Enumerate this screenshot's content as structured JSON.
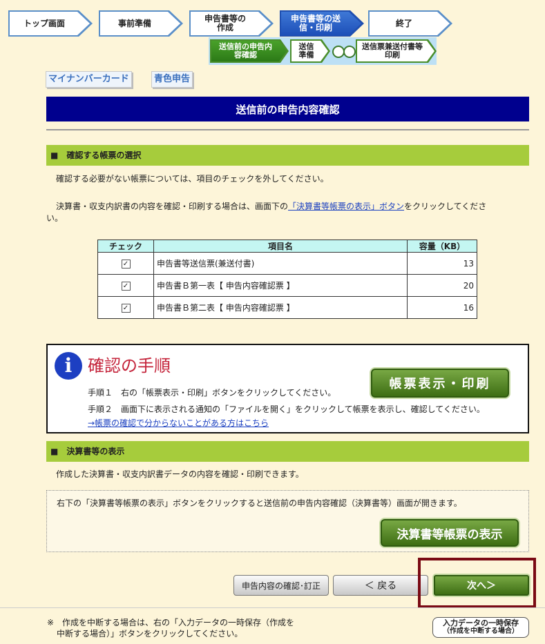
{
  "steps": [
    "トップ画面",
    "事前準備",
    "申告書等の作成",
    "申告書等の送信・印刷",
    "終了"
  ],
  "substeps": [
    "送信前の申告内容確認",
    "送信準備",
    "送信票兼送付書等印刷"
  ],
  "tags": [
    "マイナンバーカード",
    "青色申告"
  ],
  "page_title": "送信前の申告内容確認",
  "section1": {
    "heading": "■　確認する帳票の選択",
    "note1": "確認する必要がない帳票については、項目のチェックを外してください。",
    "note2_before": "決算書・収支内訳書の内容を確認・印刷する場合は、画面下の",
    "note2_link": "「決算書等帳票の表示」ボタン",
    "note2_after": "をクリックしてくださ",
    "note2_wrap": "い。"
  },
  "table": {
    "headers": [
      "チェック",
      "項目名",
      "容量（KB）"
    ],
    "rows": [
      {
        "check": "✓",
        "name": "申告書等送信票(兼送付書)",
        "size": "13"
      },
      {
        "check": "✓",
        "name": "申告書Ｂ第一表【 申告内容確認票 】",
        "size": "20"
      },
      {
        "check": "✓",
        "name": "申告書Ｂ第二表【 申告内容確認票 】",
        "size": "16"
      }
    ]
  },
  "procedure": {
    "title": "確認の手順",
    "step1": "手順１　右の「帳票表示・印刷」ボタンをクリックしてください。",
    "step2": "手順２　画面下に表示される通知の「ファイルを開く」をクリックして帳票を表示し、確認してください。",
    "help_link": "→帳票の確認で分からないことがある方はこちら",
    "button": "帳票表示・印刷"
  },
  "section2": {
    "heading": "■　決算書等の表示",
    "note": "作成した決算書・収支内訳書データの内容を確認・印刷できます。",
    "box_text": "右下の「決算書等帳票の表示」ボタンをクリックすると送信前の申告内容確認（決算書等）画面が開きます。",
    "button": "決算書等帳票の表示"
  },
  "nav": {
    "confirm": "申告内容の確認･訂正",
    "back": "＜ 戻る",
    "next": "次へ＞"
  },
  "footer": {
    "note_line1": "※　作成を中断する場合は、右の「入力データの一時保存（作成を",
    "note_line2": "中断する場合）」ボタンをクリックしてください。",
    "save_line1": "入力データの一時保存",
    "save_line2": "（作成を中断する場合）"
  },
  "colors": {
    "title_bg": "#00008e",
    "section_bg": "#a6cc3c",
    "highlight": "#7a0a14"
  }
}
